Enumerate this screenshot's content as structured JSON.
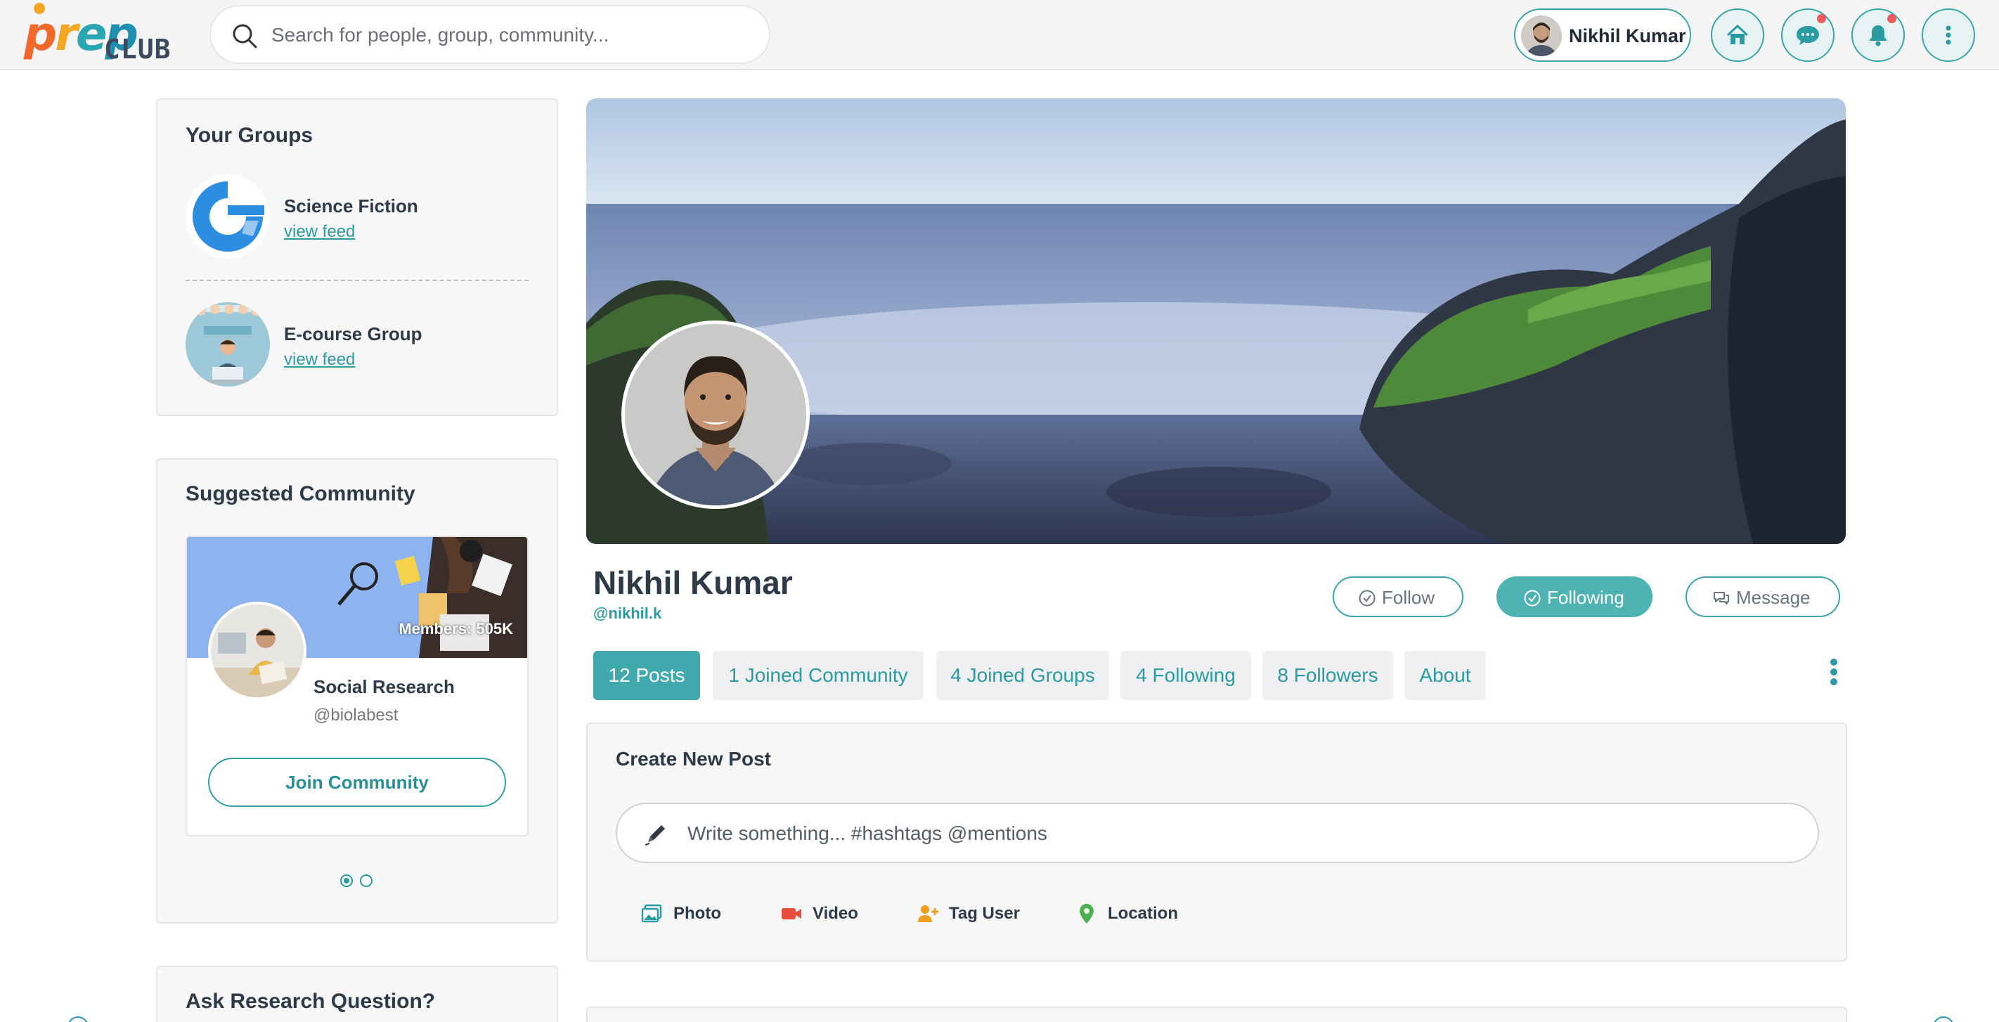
{
  "header": {
    "search_placeholder": "Search for people, group, community...",
    "user_name": "Nikhil Kumar",
    "accent_color": "#3aa6a7",
    "icons": [
      "home-icon",
      "chat-icon",
      "bell-icon",
      "more-vertical-icon"
    ]
  },
  "your_groups": {
    "title": "Your Groups",
    "items": [
      {
        "name": "Science Fiction",
        "link": "view feed"
      },
      {
        "name": "E-course Group",
        "link": "view feed"
      }
    ]
  },
  "suggested_community": {
    "title": "Suggested Community",
    "members": "Members: 505K",
    "name": "Social Research",
    "handle": "@biolabest",
    "join_label": "Join Community",
    "page": 1,
    "page_count": 2
  },
  "ask": {
    "title": "Ask Research Question?"
  },
  "profile": {
    "name": "Nikhil Kumar",
    "handle": "@nikhil.k",
    "follow_label": "Follow",
    "following_label": "Following",
    "message_label": "Message"
  },
  "tabs": [
    {
      "label": "12 Posts",
      "active": true
    },
    {
      "label": "1 Joined Community",
      "active": false
    },
    {
      "label": "4 Joined Groups",
      "active": false
    },
    {
      "label": "4 Following",
      "active": false
    },
    {
      "label": "8 Followers",
      "active": false
    },
    {
      "label": "About",
      "active": false
    }
  ],
  "create_post": {
    "title": "Create New Post",
    "placeholder": "Write something... #hashtags @mentions",
    "actions": [
      {
        "label": "Photo",
        "icon": "photo-icon",
        "color": "#2a9aa3"
      },
      {
        "label": "Video",
        "icon": "video-icon",
        "color": "#e84c3d"
      },
      {
        "label": "Tag User",
        "icon": "tag-user-icon",
        "color": "#f0a020"
      },
      {
        "label": "Location",
        "icon": "location-pin-icon",
        "color": "#4caf50"
      }
    ]
  }
}
